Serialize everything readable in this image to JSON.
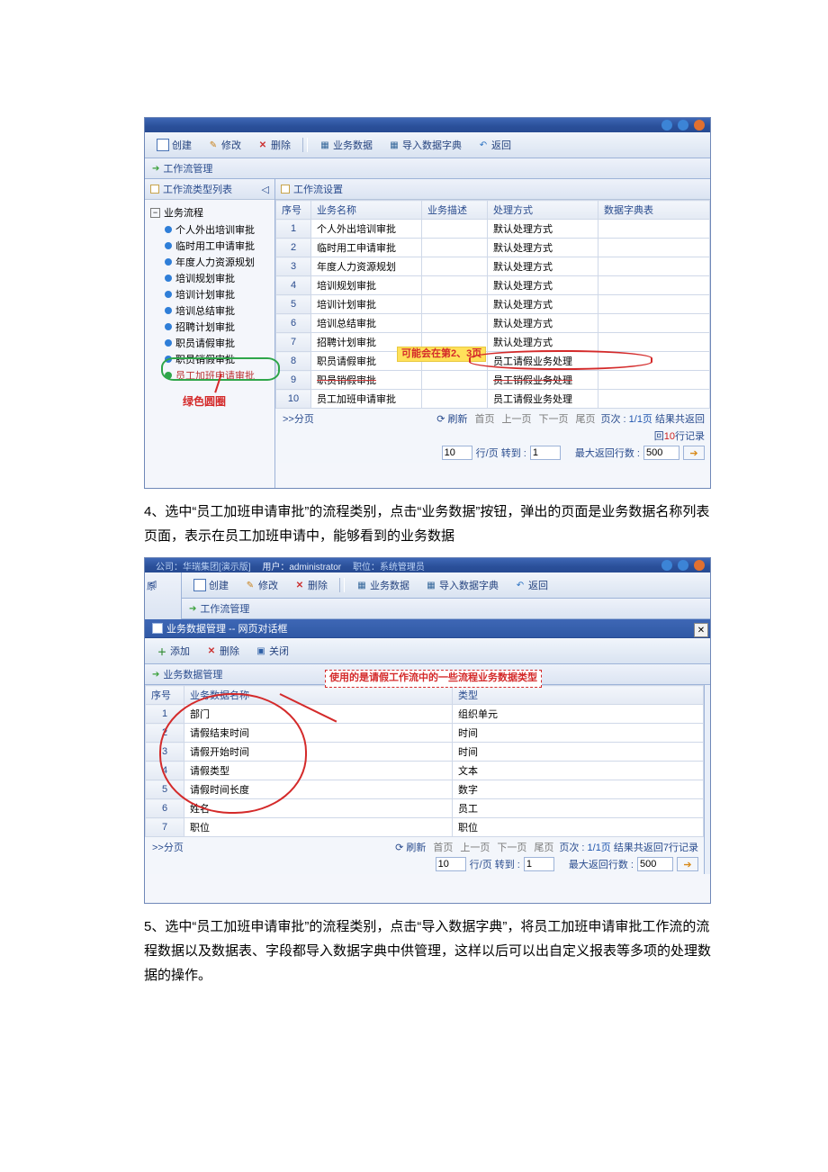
{
  "para4": "4、选中“员工加班申请审批”的流程类别，点击“业务数据”按钮，弹出的页面是业务数据名称列表页面，表示在员工加班申请中，能够看到的业务数据",
  "para5": "5、选中“员工加班申请审批”的流程类别，点击“导入数据字典”，将员工加班申请审批工作流的流程数据以及数据表、字段都导入数据字典中供管理，这样以后可以出自定义报表等多项的处理数据的操作。",
  "ss1": {
    "toolbar": {
      "new": "创建",
      "edit": "修改",
      "del": "删除",
      "bizdata": "业务数据",
      "importdict": "导入数据字典",
      "back": "返回"
    },
    "subtitle": "工作流管理",
    "tree": {
      "title": "工作流类型列表",
      "root": "业务流程",
      "items": [
        {
          "label": "个人外出培训审批"
        },
        {
          "label": "临时用工申请审批"
        },
        {
          "label": "年度人力资源规划"
        },
        {
          "label": "培训规划审批"
        },
        {
          "label": "培训计划审批"
        },
        {
          "label": "培训总结审批"
        },
        {
          "label": "招聘计划审批"
        },
        {
          "label": "职员请假审批"
        },
        {
          "label": "职员销假审批"
        },
        {
          "label": "员工加班申请审批",
          "selected": true
        }
      ]
    },
    "grid": {
      "title": "工作流设置",
      "headers": {
        "no": "序号",
        "name": "业务名称",
        "desc": "业务描述",
        "mode": "处理方式",
        "dict": "数据字典表"
      },
      "rows": [
        {
          "no": "1",
          "name": "个人外出培训审批",
          "mode": "默认处理方式"
        },
        {
          "no": "2",
          "name": "临时用工申请审批",
          "mode": "默认处理方式"
        },
        {
          "no": "3",
          "name": "年度人力资源规划",
          "mode": "默认处理方式"
        },
        {
          "no": "4",
          "name": "培训规划审批",
          "mode": "默认处理方式"
        },
        {
          "no": "5",
          "name": "培训计划审批",
          "mode": "默认处理方式"
        },
        {
          "no": "6",
          "name": "培训总结审批",
          "mode": "默认处理方式"
        },
        {
          "no": "7",
          "name": "招聘计划审批",
          "mode": "默认处理方式"
        },
        {
          "no": "8",
          "name": "职员请假审批",
          "mode": "员工请假业务处理"
        },
        {
          "no": "9",
          "name": "职员销假审批",
          "mode": "员工销假业务处理",
          "strike": true
        },
        {
          "no": "10",
          "name": "员工加班申请审批",
          "mode": "员工请假业务处理"
        }
      ]
    },
    "callout": "可能会在第2、3页",
    "green_label": "绿色圆圈",
    "pager": {
      "split": ">>分页",
      "refresh": "刷新",
      "first": "首页",
      "prev": "上一页",
      "next": "下一页",
      "last": "尾页",
      "pos_prefix": "页次 : ",
      "pos": "1/1页",
      "result_prefix": " 结果共返回",
      "result_count": "10",
      "result_suffix": "行记录",
      "rows_per": "行/页 转到 : ",
      "rpp_value": "10",
      "goto_value": "1",
      "max_label": "最大返回行数 : ",
      "max_value": "500"
    }
  },
  "ss2": {
    "title_company": "公司：华瑞集团[演示版]",
    "title_user": "用户：administrator",
    "title_role": "职位：系统管理员",
    "toolbar": {
      "new": "创建",
      "edit": "修改",
      "del": "删除",
      "bizdata": "业务数据",
      "importdict": "导入数据字典",
      "back": "返回"
    },
    "subtitle": "工作流管理",
    "dialog_tab": "业务数据管理 -- 网页对话框",
    "dtoolbar": {
      "add": "添加",
      "del": "删除",
      "close": "关闭"
    },
    "dsubtitle": "业务数据管理",
    "callout": "使用的是请假工作流中的一些流程业务数据类型",
    "grid": {
      "headers": {
        "no": "序号",
        "name": "业务数据名称",
        "type": "类型"
      },
      "rows": [
        {
          "no": "1",
          "name": "部门",
          "type": "组织单元"
        },
        {
          "no": "2",
          "name": "请假结束时间",
          "type": "时间"
        },
        {
          "no": "3",
          "name": "请假开始时间",
          "type": "时间"
        },
        {
          "no": "4",
          "name": "请假类型",
          "type": "文本"
        },
        {
          "no": "5",
          "name": "请假时间长度",
          "type": "数字"
        },
        {
          "no": "6",
          "name": "姓名",
          "type": "员工"
        },
        {
          "no": "7",
          "name": "职位",
          "type": "职位"
        }
      ]
    },
    "pager": {
      "split": ">>分页",
      "refresh": "刷新",
      "first": "首页",
      "prev": "上一页",
      "next": "下一页",
      "last": "尾页",
      "pos_prefix": "页次 : ",
      "pos": "1/1页",
      "result": " 结果共返回7行记录",
      "rows_per": "行/页 转到 : ",
      "rpp_value": "10",
      "goto_value": "1",
      "max_label": "最大返回行数 : ",
      "max_value": "500"
    }
  }
}
